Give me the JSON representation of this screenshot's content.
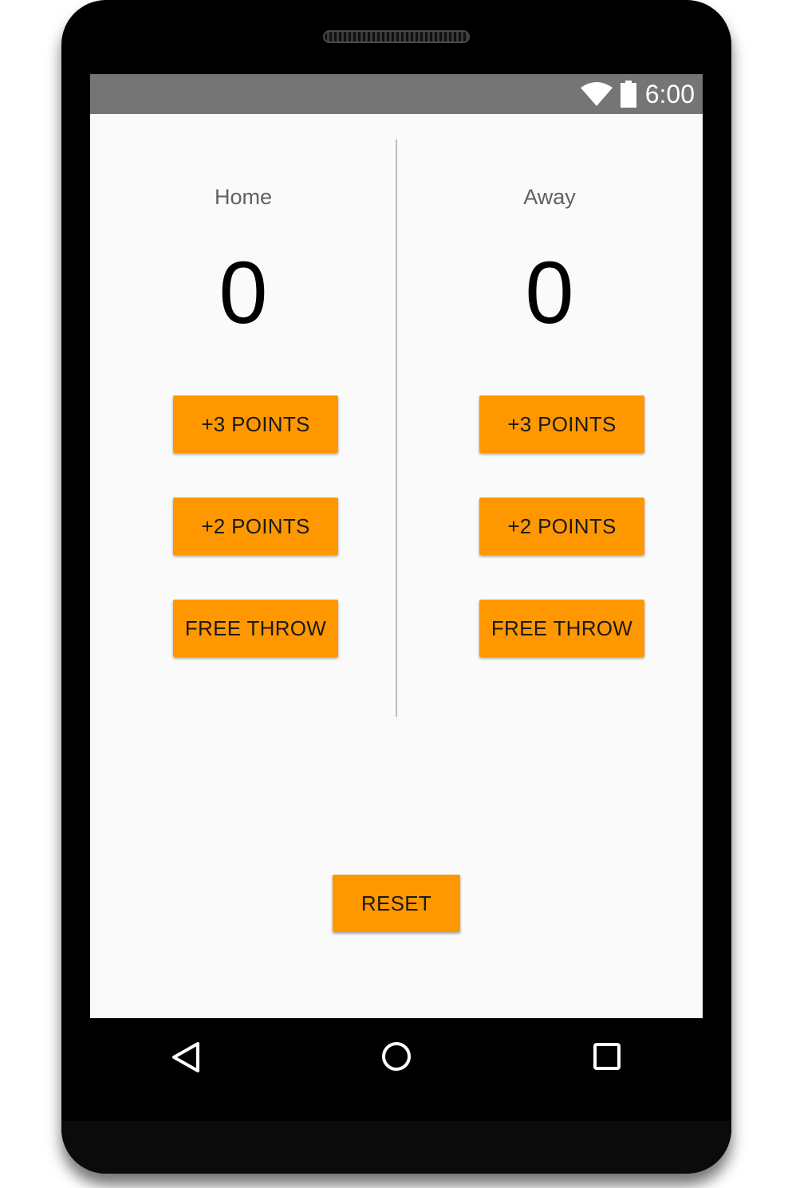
{
  "status_bar": {
    "time": "6:00",
    "wifi_icon": "wifi-icon",
    "battery_icon": "battery-icon"
  },
  "home": {
    "name": "Home",
    "score": "0",
    "btn_three": "+3 POINTS",
    "btn_two": "+2 POINTS",
    "btn_free": "FREE THROW"
  },
  "away": {
    "name": "Away",
    "score": "0",
    "btn_three": "+3 POINTS",
    "btn_two": "+2 POINTS",
    "btn_free": "FREE THROW"
  },
  "reset_label": "RESET",
  "navigation": {
    "back": "back-icon",
    "home": "home-icon",
    "recents": "recents-icon"
  },
  "colors": {
    "accent": "#ff9800",
    "status_bar": "#757575",
    "background": "#fafafa"
  }
}
